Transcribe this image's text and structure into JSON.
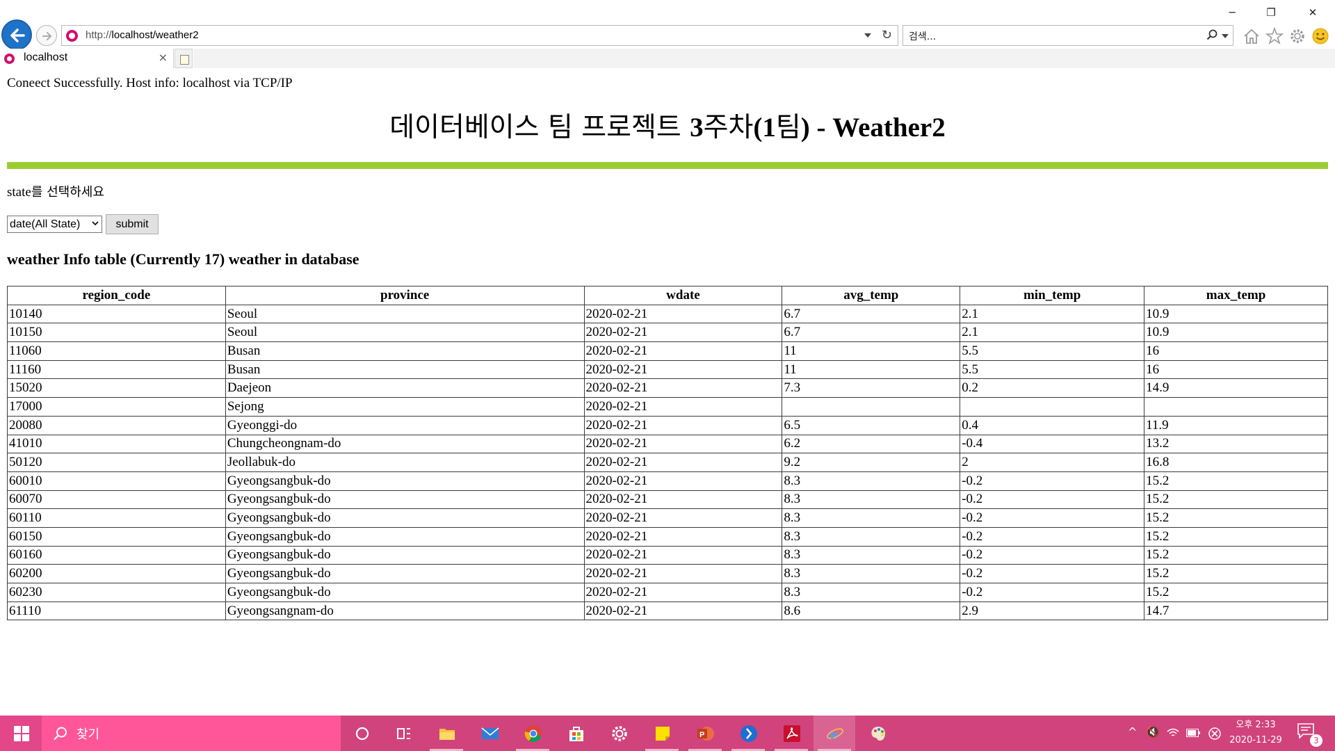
{
  "browser": {
    "window_controls": {
      "minimize": "─",
      "restore": "❐",
      "close": "✕"
    },
    "address_bar": {
      "url_prefix": "http://",
      "url_host_path": "localhost/weather2",
      "refresh": "↻"
    },
    "search_box": {
      "placeholder": "검색..."
    },
    "tab": {
      "label": "localhost",
      "close": "×"
    },
    "icons": [
      "back-icon",
      "forward-icon",
      "home-icon",
      "star-icon",
      "gear-icon",
      "smiley-icon"
    ]
  },
  "page": {
    "status": "Coneect Successfully. Host info: localhost via TCP/IP",
    "title_korean": "데이터베이스 팀 프로젝트 ",
    "title_num": "3",
    "title_korean2": "주차",
    "title_paren_open": "(1",
    "title_korean3": "팀",
    "title_rest": ") - Weather2",
    "prompt_state": "state",
    "prompt_korean": "를 선택하세요",
    "select_value": "date(All State)",
    "submit_label": "submit",
    "table_heading": "weather Info table (Currently 17) weather in database",
    "accent_color": "#9acd32"
  },
  "table": {
    "columns": [
      "region_code",
      "province",
      "wdate",
      "avg_temp",
      "min_temp",
      "max_temp"
    ],
    "rows": [
      [
        "10140",
        "Seoul",
        "2020-02-21",
        "6.7",
        "2.1",
        "10.9"
      ],
      [
        "10150",
        "Seoul",
        "2020-02-21",
        "6.7",
        "2.1",
        "10.9"
      ],
      [
        "11060",
        "Busan",
        "2020-02-21",
        "11",
        "5.5",
        "16"
      ],
      [
        "11160",
        "Busan",
        "2020-02-21",
        "11",
        "5.5",
        "16"
      ],
      [
        "15020",
        "Daejeon",
        "2020-02-21",
        "7.3",
        "0.2",
        "14.9"
      ],
      [
        "17000",
        "Sejong",
        "2020-02-21",
        "",
        "",
        ""
      ],
      [
        "20080",
        "Gyeonggi-do",
        "2020-02-21",
        "6.5",
        "0.4",
        "11.9"
      ],
      [
        "41010",
        "Chungcheongnam-do",
        "2020-02-21",
        "6.2",
        "-0.4",
        "13.2"
      ],
      [
        "50120",
        "Jeollabuk-do",
        "2020-02-21",
        "9.2",
        "2",
        "16.8"
      ],
      [
        "60010",
        "Gyeongsangbuk-do",
        "2020-02-21",
        "8.3",
        "-0.2",
        "15.2"
      ],
      [
        "60070",
        "Gyeongsangbuk-do",
        "2020-02-21",
        "8.3",
        "-0.2",
        "15.2"
      ],
      [
        "60110",
        "Gyeongsangbuk-do",
        "2020-02-21",
        "8.3",
        "-0.2",
        "15.2"
      ],
      [
        "60150",
        "Gyeongsangbuk-do",
        "2020-02-21",
        "8.3",
        "-0.2",
        "15.2"
      ],
      [
        "60160",
        "Gyeongsangbuk-do",
        "2020-02-21",
        "8.3",
        "-0.2",
        "15.2"
      ],
      [
        "60200",
        "Gyeongsangbuk-do",
        "2020-02-21",
        "8.3",
        "-0.2",
        "15.2"
      ],
      [
        "60230",
        "Gyeongsangbuk-do",
        "2020-02-21",
        "8.3",
        "-0.2",
        "15.2"
      ],
      [
        "61110",
        "Gyeongsangnam-do",
        "2020-02-21",
        "8.6",
        "2.9",
        "14.7"
      ]
    ]
  },
  "taskbar": {
    "search_placeholder": "찾기",
    "apps": [
      "cortana",
      "task-view",
      "file-explorer",
      "mail",
      "chrome",
      "store",
      "settings",
      "sticky-notes",
      "powerpoint",
      "app-blue",
      "acrobat",
      "internet-explorer",
      "paint"
    ],
    "clock_ampm_time": "오후 2:33",
    "clock_date": "2020-11-29",
    "notification_count": "3",
    "accent_color": "#d1437c"
  }
}
